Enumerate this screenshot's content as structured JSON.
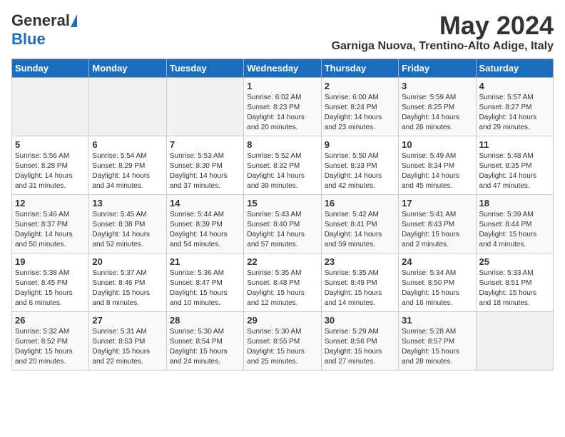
{
  "header": {
    "logo_general": "General",
    "logo_blue": "Blue",
    "month": "May 2024",
    "location": "Garniga Nuova, Trentino-Alto Adige, Italy"
  },
  "weekdays": [
    "Sunday",
    "Monday",
    "Tuesday",
    "Wednesday",
    "Thursday",
    "Friday",
    "Saturday"
  ],
  "weeks": [
    [
      {
        "day": "",
        "sunrise": "",
        "sunset": "",
        "daylight": ""
      },
      {
        "day": "",
        "sunrise": "",
        "sunset": "",
        "daylight": ""
      },
      {
        "day": "",
        "sunrise": "",
        "sunset": "",
        "daylight": ""
      },
      {
        "day": "1",
        "sunrise": "Sunrise: 6:02 AM",
        "sunset": "Sunset: 8:23 PM",
        "daylight": "Daylight: 14 hours and 20 minutes."
      },
      {
        "day": "2",
        "sunrise": "Sunrise: 6:00 AM",
        "sunset": "Sunset: 8:24 PM",
        "daylight": "Daylight: 14 hours and 23 minutes."
      },
      {
        "day": "3",
        "sunrise": "Sunrise: 5:59 AM",
        "sunset": "Sunset: 8:25 PM",
        "daylight": "Daylight: 14 hours and 26 minutes."
      },
      {
        "day": "4",
        "sunrise": "Sunrise: 5:57 AM",
        "sunset": "Sunset: 8:27 PM",
        "daylight": "Daylight: 14 hours and 29 minutes."
      }
    ],
    [
      {
        "day": "5",
        "sunrise": "Sunrise: 5:56 AM",
        "sunset": "Sunset: 8:28 PM",
        "daylight": "Daylight: 14 hours and 31 minutes."
      },
      {
        "day": "6",
        "sunrise": "Sunrise: 5:54 AM",
        "sunset": "Sunset: 8:29 PM",
        "daylight": "Daylight: 14 hours and 34 minutes."
      },
      {
        "day": "7",
        "sunrise": "Sunrise: 5:53 AM",
        "sunset": "Sunset: 8:30 PM",
        "daylight": "Daylight: 14 hours and 37 minutes."
      },
      {
        "day": "8",
        "sunrise": "Sunrise: 5:52 AM",
        "sunset": "Sunset: 8:32 PM",
        "daylight": "Daylight: 14 hours and 39 minutes."
      },
      {
        "day": "9",
        "sunrise": "Sunrise: 5:50 AM",
        "sunset": "Sunset: 8:33 PM",
        "daylight": "Daylight: 14 hours and 42 minutes."
      },
      {
        "day": "10",
        "sunrise": "Sunrise: 5:49 AM",
        "sunset": "Sunset: 8:34 PM",
        "daylight": "Daylight: 14 hours and 45 minutes."
      },
      {
        "day": "11",
        "sunrise": "Sunrise: 5:48 AM",
        "sunset": "Sunset: 8:35 PM",
        "daylight": "Daylight: 14 hours and 47 minutes."
      }
    ],
    [
      {
        "day": "12",
        "sunrise": "Sunrise: 5:46 AM",
        "sunset": "Sunset: 8:37 PM",
        "daylight": "Daylight: 14 hours and 50 minutes."
      },
      {
        "day": "13",
        "sunrise": "Sunrise: 5:45 AM",
        "sunset": "Sunset: 8:38 PM",
        "daylight": "Daylight: 14 hours and 52 minutes."
      },
      {
        "day": "14",
        "sunrise": "Sunrise: 5:44 AM",
        "sunset": "Sunset: 8:39 PM",
        "daylight": "Daylight: 14 hours and 54 minutes."
      },
      {
        "day": "15",
        "sunrise": "Sunrise: 5:43 AM",
        "sunset": "Sunset: 8:40 PM",
        "daylight": "Daylight: 14 hours and 57 minutes."
      },
      {
        "day": "16",
        "sunrise": "Sunrise: 5:42 AM",
        "sunset": "Sunset: 8:41 PM",
        "daylight": "Daylight: 14 hours and 59 minutes."
      },
      {
        "day": "17",
        "sunrise": "Sunrise: 5:41 AM",
        "sunset": "Sunset: 8:43 PM",
        "daylight": "Daylight: 15 hours and 2 minutes."
      },
      {
        "day": "18",
        "sunrise": "Sunrise: 5:39 AM",
        "sunset": "Sunset: 8:44 PM",
        "daylight": "Daylight: 15 hours and 4 minutes."
      }
    ],
    [
      {
        "day": "19",
        "sunrise": "Sunrise: 5:38 AM",
        "sunset": "Sunset: 8:45 PM",
        "daylight": "Daylight: 15 hours and 6 minutes."
      },
      {
        "day": "20",
        "sunrise": "Sunrise: 5:37 AM",
        "sunset": "Sunset: 8:46 PM",
        "daylight": "Daylight: 15 hours and 8 minutes."
      },
      {
        "day": "21",
        "sunrise": "Sunrise: 5:36 AM",
        "sunset": "Sunset: 8:47 PM",
        "daylight": "Daylight: 15 hours and 10 minutes."
      },
      {
        "day": "22",
        "sunrise": "Sunrise: 5:35 AM",
        "sunset": "Sunset: 8:48 PM",
        "daylight": "Daylight: 15 hours and 12 minutes."
      },
      {
        "day": "23",
        "sunrise": "Sunrise: 5:35 AM",
        "sunset": "Sunset: 8:49 PM",
        "daylight": "Daylight: 15 hours and 14 minutes."
      },
      {
        "day": "24",
        "sunrise": "Sunrise: 5:34 AM",
        "sunset": "Sunset: 8:50 PM",
        "daylight": "Daylight: 15 hours and 16 minutes."
      },
      {
        "day": "25",
        "sunrise": "Sunrise: 5:33 AM",
        "sunset": "Sunset: 8:51 PM",
        "daylight": "Daylight: 15 hours and 18 minutes."
      }
    ],
    [
      {
        "day": "26",
        "sunrise": "Sunrise: 5:32 AM",
        "sunset": "Sunset: 8:52 PM",
        "daylight": "Daylight: 15 hours and 20 minutes."
      },
      {
        "day": "27",
        "sunrise": "Sunrise: 5:31 AM",
        "sunset": "Sunset: 8:53 PM",
        "daylight": "Daylight: 15 hours and 22 minutes."
      },
      {
        "day": "28",
        "sunrise": "Sunrise: 5:30 AM",
        "sunset": "Sunset: 8:54 PM",
        "daylight": "Daylight: 15 hours and 24 minutes."
      },
      {
        "day": "29",
        "sunrise": "Sunrise: 5:30 AM",
        "sunset": "Sunset: 8:55 PM",
        "daylight": "Daylight: 15 hours and 25 minutes."
      },
      {
        "day": "30",
        "sunrise": "Sunrise: 5:29 AM",
        "sunset": "Sunset: 8:56 PM",
        "daylight": "Daylight: 15 hours and 27 minutes."
      },
      {
        "day": "31",
        "sunrise": "Sunrise: 5:28 AM",
        "sunset": "Sunset: 8:57 PM",
        "daylight": "Daylight: 15 hours and 28 minutes."
      },
      {
        "day": "",
        "sunrise": "",
        "sunset": "",
        "daylight": ""
      }
    ]
  ]
}
